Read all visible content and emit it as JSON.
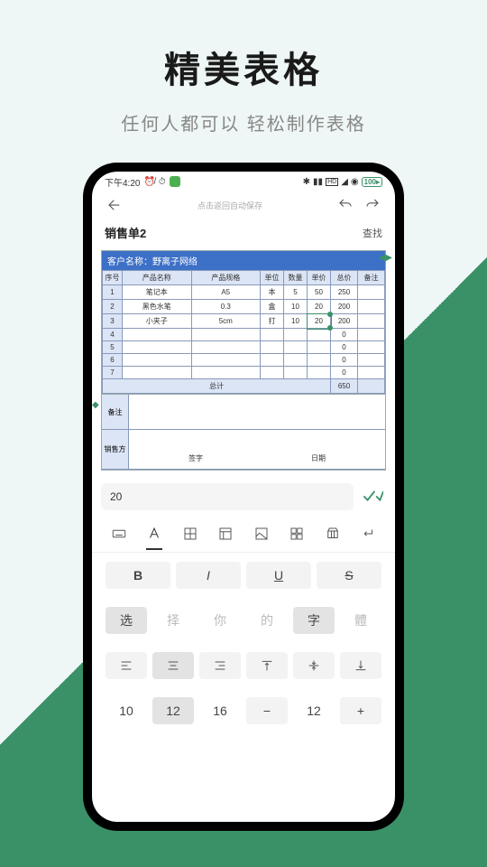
{
  "marketing": {
    "title": "精美表格",
    "subtitle": "任何人都可以  轻松制作表格"
  },
  "status": {
    "time": "下午4:20",
    "battery": "100"
  },
  "topbar": {
    "hint": "点击返回自动保存"
  },
  "doc": {
    "title": "销售单2",
    "find": "查找"
  },
  "sheet": {
    "customer_label": "客户名称：野离子网络",
    "cols": [
      "序号",
      "产品名称",
      "产品规格",
      "单位",
      "数量",
      "单价",
      "总价",
      "备注"
    ],
    "rows": [
      {
        "idx": "1",
        "name": "笔记本",
        "spec": "A5",
        "unit": "本",
        "qty": "5",
        "price": "50",
        "total": "250",
        "note": ""
      },
      {
        "idx": "2",
        "name": "黑色水笔",
        "spec": "0.3",
        "unit": "盒",
        "qty": "10",
        "price": "20",
        "total": "200",
        "note": ""
      },
      {
        "idx": "3",
        "name": "小夹子",
        "spec": "5cm",
        "unit": "打",
        "qty": "10",
        "price": "20",
        "total": "200",
        "note": ""
      },
      {
        "idx": "4",
        "name": "",
        "spec": "",
        "unit": "",
        "qty": "",
        "price": "",
        "total": "0",
        "note": ""
      },
      {
        "idx": "5",
        "name": "",
        "spec": "",
        "unit": "",
        "qty": "",
        "price": "",
        "total": "0",
        "note": ""
      },
      {
        "idx": "6",
        "name": "",
        "spec": "",
        "unit": "",
        "qty": "",
        "price": "",
        "total": "0",
        "note": ""
      },
      {
        "idx": "7",
        "name": "",
        "spec": "",
        "unit": "",
        "qty": "",
        "price": "",
        "total": "0",
        "note": ""
      }
    ],
    "total_label": "总计",
    "total_value": "650",
    "remark_label": "备注",
    "seller_label": "销售方",
    "sign_label": "签字",
    "date_label": "日期"
  },
  "input": {
    "value": "20"
  },
  "fonts": {
    "choices": [
      "选",
      "择",
      "你",
      "的",
      "字",
      "體"
    ]
  },
  "sizes": {
    "values": [
      "10",
      "12",
      "16"
    ],
    "current": "12"
  }
}
